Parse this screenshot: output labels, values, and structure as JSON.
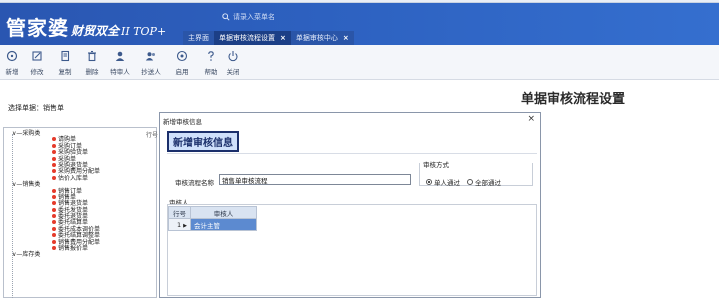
{
  "header": {
    "brand_main": "管家婆",
    "brand_sub": "财贸双全",
    "brand_ver": "II TOP+",
    "search_placeholder": "请录入菜单名",
    "tabs": [
      {
        "label": "主界面",
        "closable": false
      },
      {
        "label": "单据审核流程设置",
        "closable": true,
        "close": "×"
      },
      {
        "label": "单据审核中心",
        "closable": true,
        "close": "×"
      }
    ]
  },
  "toolbar": {
    "buttons": [
      {
        "label": "新增",
        "icon": "circle-plus-icon"
      },
      {
        "label": "修改",
        "icon": "edit-icon"
      },
      {
        "label": "复制",
        "icon": "copy-icon"
      },
      {
        "label": "删除",
        "icon": "trash-icon"
      },
      {
        "label": "特审人",
        "icon": "user-icon"
      },
      {
        "label": "抄送人",
        "icon": "users-icon"
      },
      {
        "label": "启用",
        "icon": "target-icon"
      },
      {
        "label": "帮助",
        "icon": "help-icon"
      },
      {
        "label": "关闭",
        "icon": "power-icon"
      }
    ]
  },
  "page": {
    "title": "单据审核流程设置",
    "doc_select_label": "选择单据：销售单",
    "grid_header_partial": "行号"
  },
  "tree": {
    "categories": [
      {
        "name": "采购类",
        "items": [
          "请购单",
          "采购订单",
          "采购验货单",
          "采购单",
          "采购退货单",
          "采购费用分配单",
          "估价入库单"
        ]
      },
      {
        "name": "销售类",
        "items": [
          "销售订单",
          "销售单",
          "销售退货单",
          "委托发货单",
          "委托退货单",
          "委托结算单",
          "委托成本调价单",
          "委托结算调整单",
          "销售费用分配单",
          "销售报价单"
        ]
      },
      {
        "name": "库存类",
        "items": []
      }
    ]
  },
  "dialog": {
    "title": "新增审核信息",
    "heading": "新增审核信息",
    "close": "×",
    "method_legend": "审核方式",
    "method_options": [
      "单人通过",
      "全部通过"
    ],
    "method_selected": "单人通过",
    "flow_name_label": "审核流程名称",
    "flow_name_value": "销售单审核流程",
    "approver_label": "审核人",
    "grid": {
      "headers": [
        "行号",
        "审核人"
      ],
      "rows": [
        {
          "no": "1",
          "approver": "会计主管"
        }
      ]
    }
  },
  "colors": {
    "header_bg": "#2d61c0",
    "active_tab": "#1c3f86",
    "heading_box_bg": "#cfe0fb",
    "selected_cell": "#5c8ad0",
    "tree_dot": "#e53b2b"
  }
}
